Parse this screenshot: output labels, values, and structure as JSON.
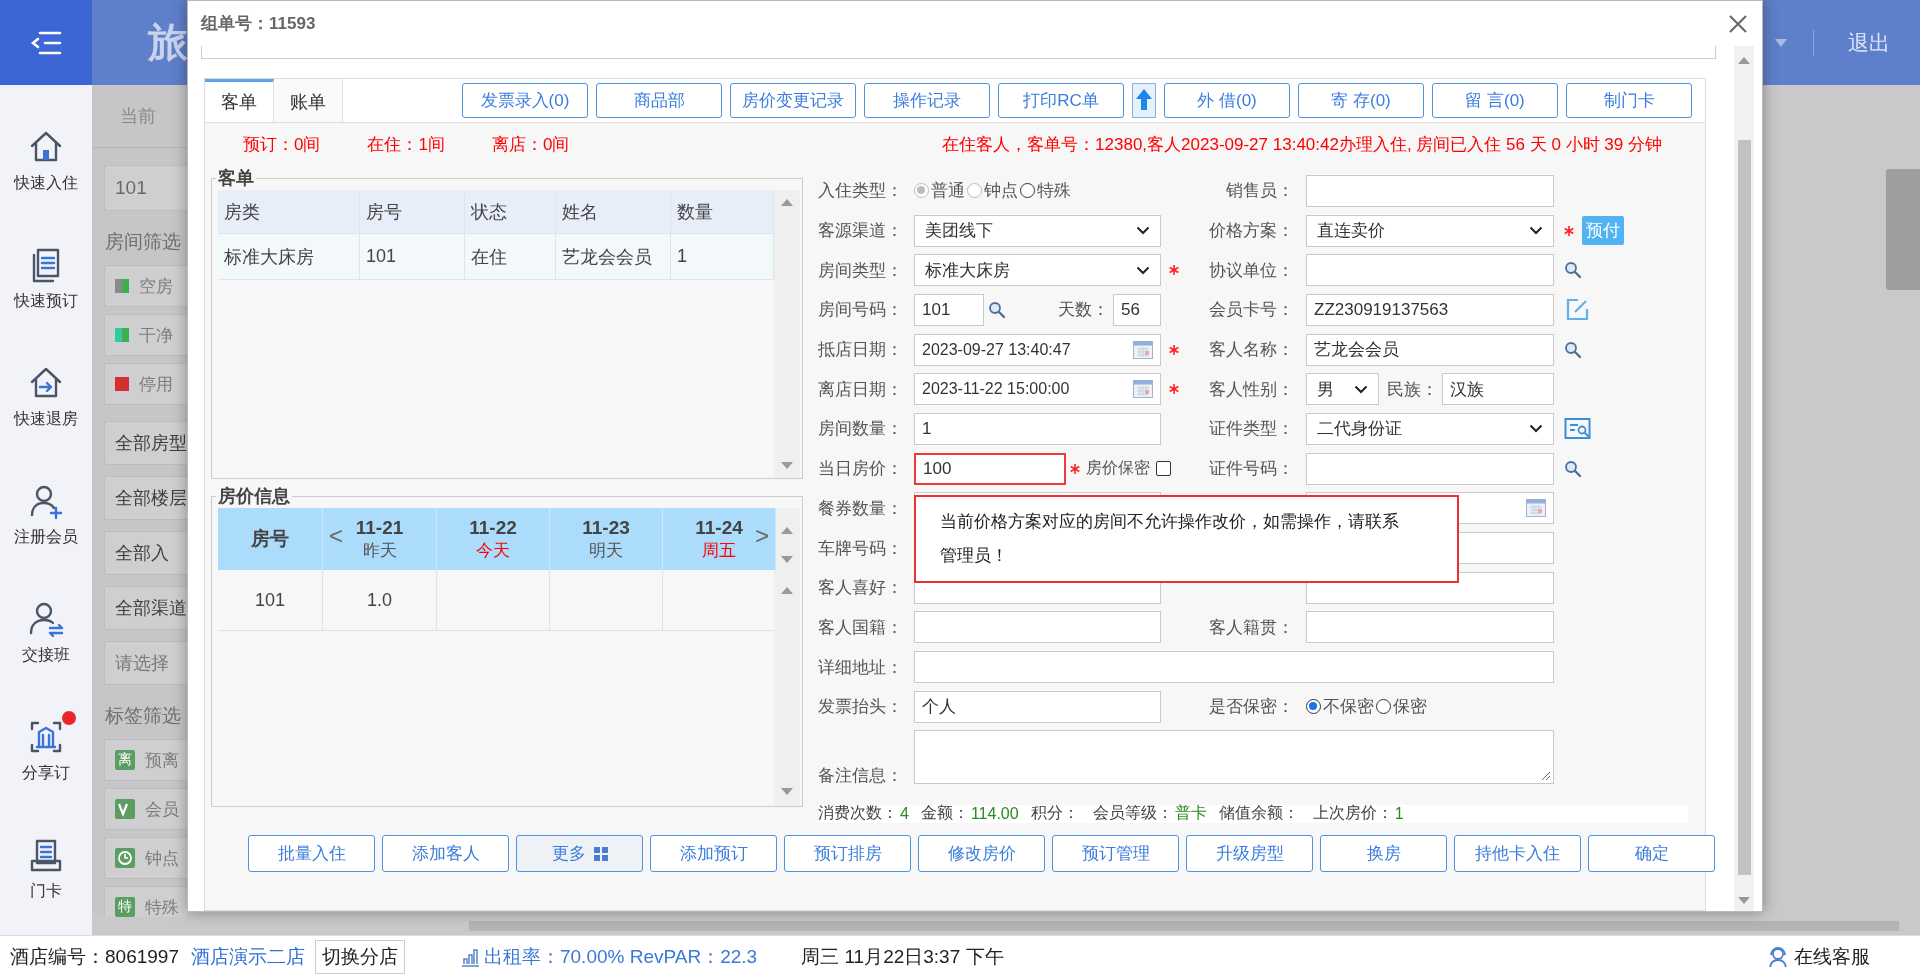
{
  "sidebar": {
    "items": [
      {
        "label": "快速入住",
        "notification": false
      },
      {
        "label": "快速预订",
        "notification": false
      },
      {
        "label": "快速退房",
        "notification": false
      },
      {
        "label": "注册会员",
        "notification": false
      },
      {
        "label": "交接班",
        "notification": false
      },
      {
        "label": "分享订",
        "notification": true
      },
      {
        "label": "门卡",
        "notification": false
      }
    ]
  },
  "app_header": {
    "title": "旅",
    "logout": "退出"
  },
  "room_panel": {
    "heading": "当前",
    "search_value": "101",
    "room_filter_title": "房间筛选",
    "room_filters": [
      {
        "label": "空房",
        "kind": "split",
        "color": "#8a8a8a"
      },
      {
        "label": "干净",
        "kind": "split",
        "color": "#35c9a2"
      },
      {
        "label": "停用",
        "kind": "solid",
        "color": "#d33030"
      }
    ],
    "selects": [
      "全部房型",
      "全部楼层",
      "全部入",
      "全部渠道"
    ],
    "feature_placeholder": "请选择",
    "tag_filter_title": "标签筛选",
    "tag_filters": [
      {
        "kind": "text",
        "badge": "离",
        "label": "预离"
      },
      {
        "kind": "vip",
        "label": "会员"
      },
      {
        "kind": "clock",
        "label": "钟点"
      },
      {
        "kind": "text",
        "badge": "特",
        "label": "特殊"
      }
    ]
  },
  "dialog": {
    "title": "组单号：11593",
    "tabs": [
      {
        "label": "客单",
        "selected": true
      },
      {
        "label": "账单",
        "selected": false
      }
    ],
    "toolbar": [
      {
        "kind": "button",
        "label": "发票录入(0)"
      },
      {
        "kind": "button",
        "label": "商品部"
      },
      {
        "kind": "button",
        "label": "房价变更记录"
      },
      {
        "kind": "button",
        "label": "操作记录"
      },
      {
        "kind": "button",
        "label": "打印RC单"
      },
      {
        "kind": "upload"
      },
      {
        "kind": "button",
        "label": "外 借(0)"
      },
      {
        "kind": "button",
        "label": "寄 存(0)"
      },
      {
        "kind": "button",
        "label": "留 言(0)"
      },
      {
        "kind": "button",
        "label": "制门卡"
      }
    ],
    "counts": [
      "预订：0间",
      "在住：1间",
      "离店：0间"
    ],
    "status_message": "在住客人，客单号：12380,客人2023-09-27 13:40:42办理入住, 房间已入住 56 天 0 小时 39 分钟",
    "guest_list": {
      "title": "客单",
      "columns": [
        "房类",
        "房号",
        "状态",
        "姓名",
        "数量"
      ],
      "rows": [
        [
          "标准大床房",
          "101",
          "在住",
          "艺龙会会员",
          "1"
        ]
      ]
    },
    "rate_info": {
      "title": "房价信息",
      "room_header": "房号",
      "prev": "<",
      "next": ">",
      "dates": [
        {
          "date": "11-21",
          "day": "昨天",
          "highlight": false
        },
        {
          "date": "11-22",
          "day": "今天",
          "highlight": true
        },
        {
          "date": "11-23",
          "day": "明天",
          "highlight": false
        },
        {
          "date": "11-24",
          "day": "周五",
          "highlight": true
        }
      ],
      "rows": [
        {
          "room": "101",
          "prices": [
            "1.0"
          ]
        }
      ]
    },
    "form_rows": [
      {
        "left": {
          "kind": "radio",
          "label": "入住类型：",
          "options": [
            {
              "label": "普通",
              "selected": true,
              "disabled": true
            },
            {
              "label": "钟点",
              "selected": false,
              "disabled": true
            },
            {
              "label": "特殊",
              "selected": false,
              "disabled": false
            }
          ]
        },
        "right": {
          "kind": "text",
          "label": "销售员："
        }
      },
      {
        "left": {
          "kind": "select",
          "label": "客源渠道：",
          "value": "美团线下"
        },
        "right": {
          "kind": "select",
          "label": "价格方案：",
          "value": "直连卖价",
          "required": true,
          "tag": "预付"
        }
      },
      {
        "left": {
          "kind": "select",
          "label": "房间类型：",
          "value": "标准大床房",
          "required": true
        },
        "right": {
          "kind": "text",
          "label": "协议单位：",
          "action": {
            "kind": "search"
          }
        }
      },
      {
        "left": {
          "kind": "room",
          "label": "房间号码：",
          "value": "101",
          "days_label": "天数：",
          "days": "56"
        },
        "right": {
          "kind": "text",
          "label": "会员卡号：",
          "value": "ZZ230919137563",
          "action": {
            "kind": "edit"
          }
        }
      },
      {
        "left": {
          "kind": "date",
          "label": "抵店日期：",
          "value": "2023-09-27 13:40:47",
          "required": true
        },
        "right": {
          "kind": "text",
          "label": "客人名称：",
          "value": "艺龙会会员",
          "action": {
            "kind": "search"
          }
        }
      },
      {
        "left": {
          "kind": "date",
          "label": "离店日期：",
          "value": "2023-11-22 15:00:00",
          "required": true
        },
        "right": {
          "kind": "gender",
          "label": "客人性别：",
          "value": "男",
          "ethnic_label": "民族：",
          "ethnic": "汉族"
        }
      },
      {
        "left": {
          "kind": "text",
          "label": "房间数量：",
          "value": "1"
        },
        "right": {
          "kind": "select",
          "label": "证件类型：",
          "value": "二代身份证",
          "action": {
            "kind": "scan"
          }
        }
      },
      {
        "left": {
          "kind": "price",
          "label": "当日房价：",
          "value": "100",
          "required": true,
          "error": true,
          "secret_label": "房价保密",
          "secret": false
        },
        "right": {
          "kind": "text",
          "label": "证件号码：",
          "action": {
            "kind": "search"
          }
        }
      },
      {
        "left": {
          "kind": "text",
          "label": "餐券数量："
        },
        "right": {
          "kind": "date"
        }
      },
      {
        "left": {
          "kind": "label",
          "label": "车牌号码："
        },
        "right": {
          "kind": "text"
        }
      },
      {
        "left": {
          "kind": "text",
          "label": "客人喜好："
        },
        "right": {
          "kind": "text"
        }
      },
      {
        "left": {
          "kind": "text",
          "label": "客人国籍："
        },
        "right": {
          "kind": "text",
          "label": "客人籍贯："
        }
      },
      {
        "left": {
          "kind": "wide",
          "label": "详细地址："
        }
      },
      {
        "left": {
          "kind": "text",
          "label": "发票抬头：",
          "value": "个人"
        },
        "right": {
          "kind": "radio",
          "label": "是否保密：",
          "options": [
            {
              "label": "不保密",
              "selected": true,
              "disabled": false
            },
            {
              "label": "保密",
              "selected": false,
              "disabled": false
            }
          ]
        }
      },
      {
        "left": {
          "kind": "textarea",
          "label": "备注信息："
        }
      }
    ],
    "summary": [
      {
        "label": "消费次数：",
        "value": "4"
      },
      {
        "label": "金额：",
        "value": "114.00"
      },
      {
        "label": "积分："
      },
      {
        "label": "会员等级：",
        "value": "普卡"
      },
      {
        "label": "储值余额："
      },
      {
        "label": "上次房价：",
        "value": "1"
      }
    ],
    "actions": [
      {
        "kind": "button",
        "label": "批量入住"
      },
      {
        "kind": "button",
        "label": "添加客人"
      },
      {
        "kind": "menu",
        "label": "更多"
      },
      {
        "kind": "button",
        "label": "添加预订"
      },
      {
        "kind": "button",
        "label": "预订排房"
      },
      {
        "kind": "button",
        "label": "修改房价"
      },
      {
        "kind": "button",
        "label": "预订管理"
      },
      {
        "kind": "button",
        "label": "升级房型"
      },
      {
        "kind": "button",
        "label": "换房"
      },
      {
        "kind": "button",
        "label": "持他卡入住"
      },
      {
        "kind": "button",
        "label": "确定"
      }
    ],
    "tooltip": "当前价格方案对应的房间不允许操作改价，如需操作，请联系管理员！"
  },
  "status_bar": {
    "hotel_id": "酒店编号：8061997",
    "hotel_name": "酒店演示二店",
    "switch": "切换分店",
    "occupancy": "出租率：70.00% RevPAR：22.3",
    "datetime": "周三 11月22日3:37 下午",
    "support": "在线客服"
  }
}
